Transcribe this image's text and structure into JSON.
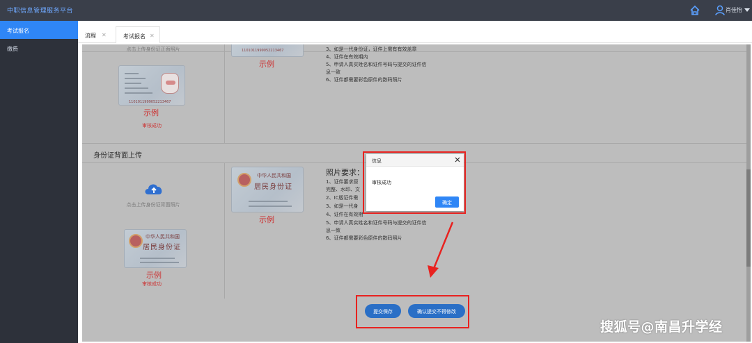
{
  "app": {
    "title": "中职信息管理服务平台"
  },
  "user": {
    "name": "肖佳怡"
  },
  "sidebar": {
    "items": [
      {
        "label": "考试报名"
      },
      {
        "label": "缴费"
      }
    ]
  },
  "tabs": [
    {
      "label": "流程"
    },
    {
      "label": "考试报名"
    }
  ],
  "front_panel": {
    "upload_hint": "点击上传身份证正面照片",
    "example_label": "示例",
    "status": "审核成功",
    "sample_top_label": "示例",
    "card_number_text": "1101011999052213467"
  },
  "front_requirements": {
    "lines": [
      "3、如是一代身份证，证件上需有有效盖章",
      "4、证件在有效期内",
      "5、申请人真实姓名和证件号码与提交的证件信",
      "息一致",
      "6、证件都需要彩色原件的数码照片"
    ]
  },
  "back_section": {
    "title": "身份证背面上传",
    "upload_hint": "点击上传身份证背面照片",
    "example_label": "示例",
    "status": "审核成功",
    "sample_example_label": "示例",
    "card_title_small": "中华人民共和国",
    "card_title_large": "居民身份证"
  },
  "back_requirements": {
    "title": "照片要求：",
    "lines": [
      "1、证件要求原",
      "完整、水印、文",
      "2、IC版证件需",
      "3、如是一代身",
      "4、证件在有效期",
      "5、申请人真实姓名和证件号码与提交的证件信",
      "息一致",
      "6、证件都需要彩色原件的数码照片"
    ]
  },
  "actions": {
    "save_label": "提交保存",
    "confirm_label": "确认提交不得修改"
  },
  "dialog": {
    "title": "信息",
    "message": "审核成功",
    "ok_label": "确定"
  },
  "watermark": "搜狐号@南昌升学经",
  "colors": {
    "accent": "#2f86f6",
    "highlight": "#e8221f",
    "status": "#cc3333"
  }
}
